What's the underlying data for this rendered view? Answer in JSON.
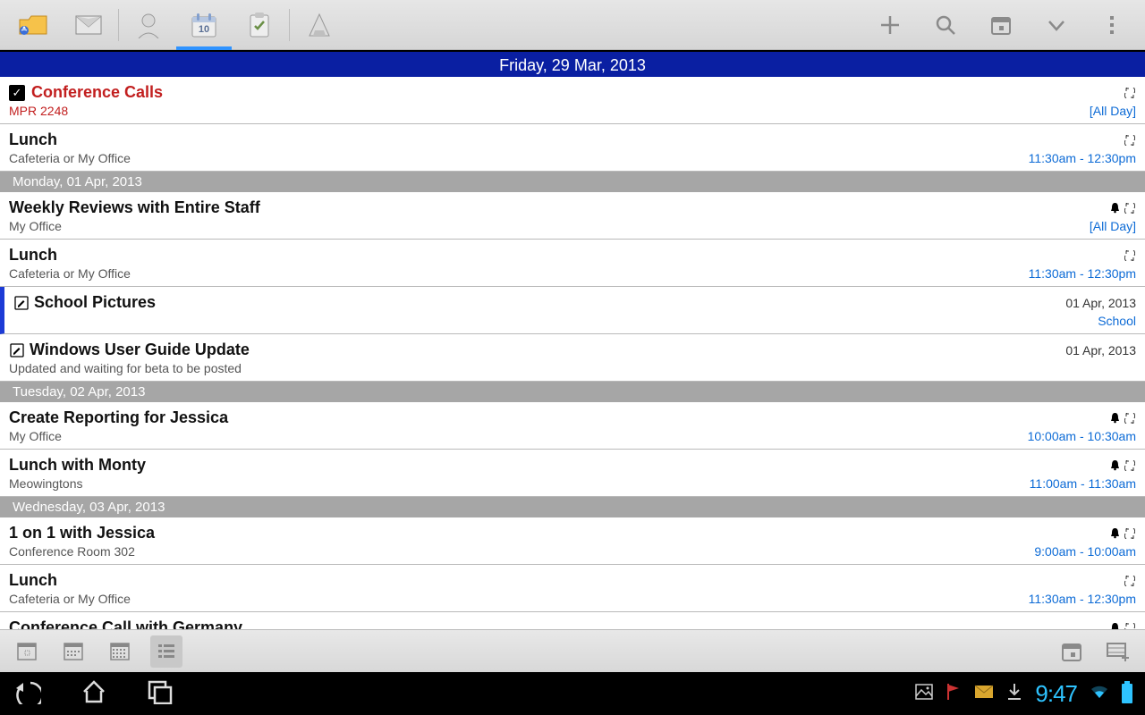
{
  "header_date": "Friday, 29 Mar, 2013",
  "days": [
    {
      "header": null,
      "events": [
        {
          "title": "Conference Calls",
          "title_red": true,
          "loc": "MPR 2248",
          "loc_red": true,
          "time": "[All Day]",
          "chk": true,
          "recur": true,
          "bell": false
        },
        {
          "title": "Lunch",
          "loc": "Cafeteria or My Office",
          "time": "11:30am - 12:30pm",
          "recur": true,
          "bell": false
        }
      ]
    },
    {
      "header": "Monday, 01 Apr, 2013",
      "events": [
        {
          "title": "Weekly Reviews with Entire Staff",
          "loc": "My Office",
          "time": "[All Day]",
          "recur": true,
          "bell": true
        },
        {
          "title": "Lunch",
          "loc": "Cafeteria or My Office",
          "time": "11:30am - 12:30pm",
          "recur": true,
          "bell": false
        },
        {
          "title": "School Pictures",
          "task": true,
          "blue": true,
          "right_date": "01 Apr, 2013",
          "school": "School"
        },
        {
          "title": "Windows User Guide Update",
          "task": true,
          "loc": "Updated and waiting for beta to be posted",
          "right_date": "01 Apr, 2013"
        }
      ]
    },
    {
      "header": "Tuesday, 02 Apr, 2013",
      "events": [
        {
          "title": "Create Reporting for Jessica",
          "loc": "My Office",
          "time": "10:00am - 10:30am",
          "recur": true,
          "bell": true
        },
        {
          "title": "Lunch with Monty",
          "loc": "Meowingtons",
          "time": "11:00am - 11:30am",
          "recur": true,
          "bell": true
        }
      ]
    },
    {
      "header": "Wednesday, 03 Apr, 2013",
      "events": [
        {
          "title": "1 on 1 with Jessica",
          "loc": "Conference Room 302",
          "time": "9:00am - 10:00am",
          "recur": true,
          "bell": true
        },
        {
          "title": "Lunch",
          "loc": "Cafeteria or My Office",
          "time": "11:30am - 12:30pm",
          "recur": true,
          "bell": false
        },
        {
          "title": "Conference Call with Germany",
          "recur": true,
          "bell": true
        }
      ]
    }
  ],
  "status": {
    "time": "9:47"
  }
}
